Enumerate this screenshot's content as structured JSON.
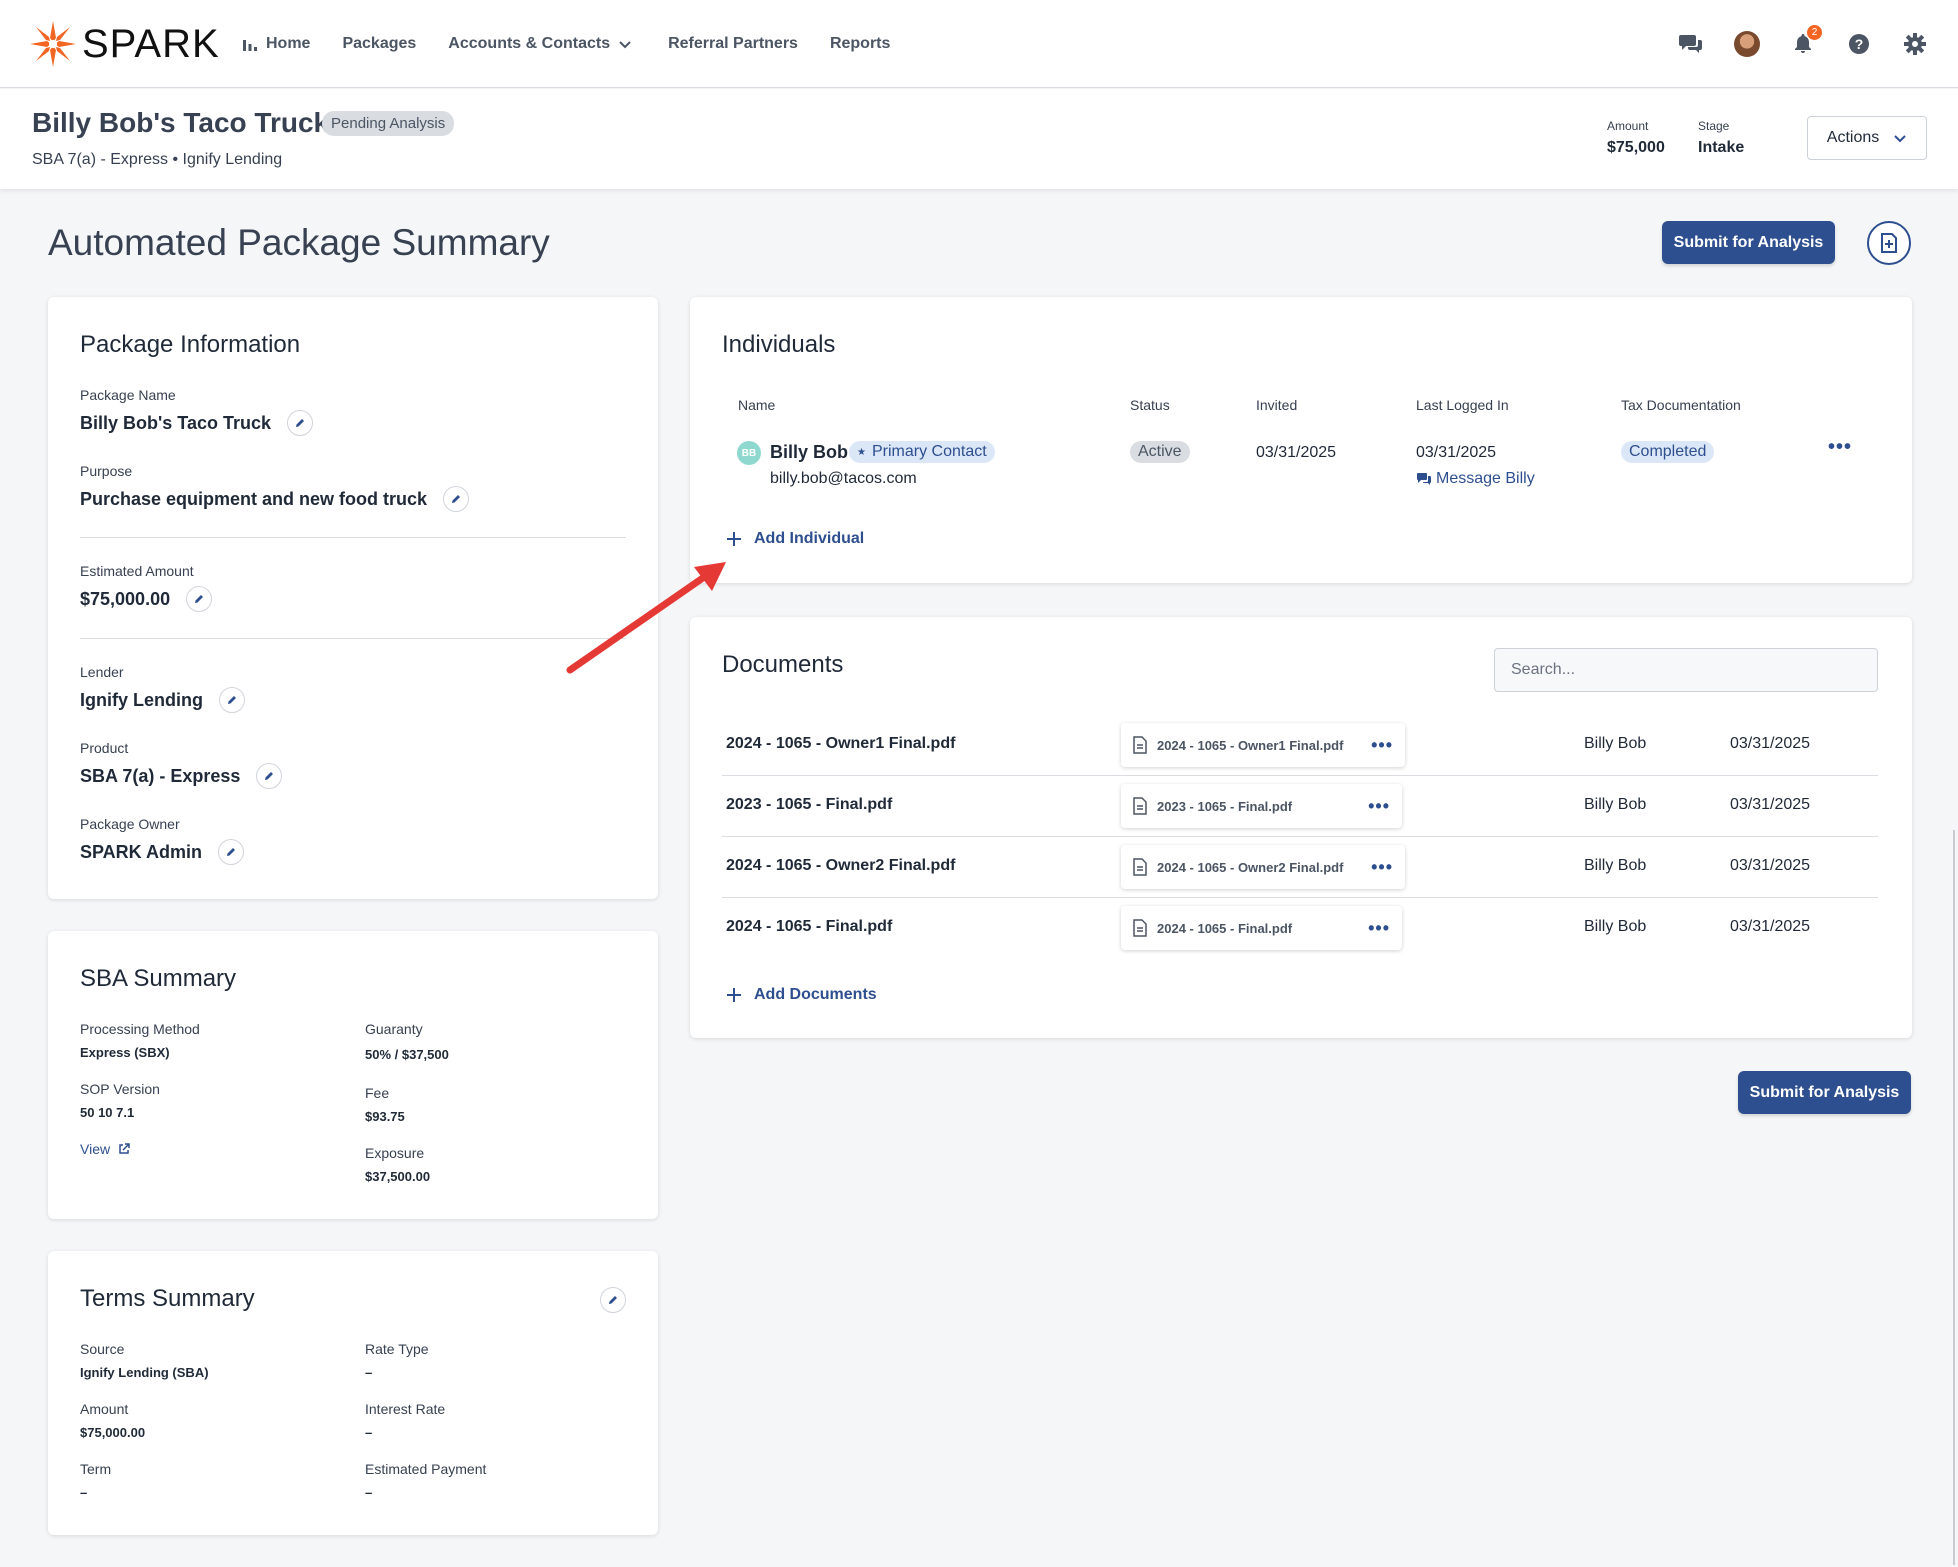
{
  "brand": {
    "name": "SPARK",
    "accent": "#f26522",
    "primary": "#2e4f8f"
  },
  "nav": {
    "items": [
      {
        "label": "Home",
        "icon": "bar-chart-icon"
      },
      {
        "label": "Packages"
      },
      {
        "label": "Accounts & Contacts",
        "icon": "chevron-down-icon"
      },
      {
        "label": "Referral Partners"
      },
      {
        "label": "Reports"
      }
    ],
    "notification_count": "2"
  },
  "header": {
    "title": "Billy Bob's Taco Truck",
    "status": "Pending Analysis",
    "subtitle": "SBA 7(a) - Express • Ignify Lending",
    "amount_label": "Amount",
    "amount_value": "$75,000",
    "stage_label": "Stage",
    "stage_value": "Intake",
    "actions_label": "Actions"
  },
  "page": {
    "title": "Automated Package Summary",
    "submit_label": "Submit for Analysis"
  },
  "package_info": {
    "title": "Package Information",
    "name_label": "Package Name",
    "name_value": "Billy Bob's Taco Truck",
    "purpose_label": "Purpose",
    "purpose_value": "Purchase equipment and new food truck",
    "estimated_label": "Estimated Amount",
    "estimated_value": "$75,000.00",
    "lender_label": "Lender",
    "lender_value": "Ignify Lending",
    "product_label": "Product",
    "product_value": "SBA 7(a) - Express",
    "owner_label": "Package Owner",
    "owner_value": "SPARK Admin"
  },
  "sba_summary": {
    "title": "SBA Summary",
    "processing_label": "Processing Method",
    "processing_value": "Express (SBX)",
    "sop_label": "SOP Version",
    "sop_value": "50 10 7.1",
    "view_label": "View",
    "guaranty_label": "Guaranty",
    "guaranty_value": "50% / $37,500",
    "fee_label": "Fee",
    "fee_value": "$93.75",
    "exposure_label": "Exposure",
    "exposure_value": "$37,500.00"
  },
  "terms_summary": {
    "title": "Terms Summary",
    "source_label": "Source",
    "source_value": "Ignify Lending (SBA)",
    "amount_label": "Amount",
    "amount_value": "$75,000.00",
    "term_label": "Term",
    "term_value": "–",
    "rate_type_label": "Rate Type",
    "rate_type_value": "–",
    "interest_label": "Interest Rate",
    "interest_value": "–",
    "payment_label": "Estimated Payment",
    "payment_value": "–"
  },
  "individuals": {
    "title": "Individuals",
    "columns": [
      "Name",
      "Status",
      "Invited",
      "Last Logged In",
      "Tax Documentation"
    ],
    "rows": [
      {
        "initials": "BB",
        "name": "Billy Bob",
        "role": "Primary Contact",
        "email": "billy.bob@tacos.com",
        "status": "Active",
        "invited": "03/31/2025",
        "last_logged_in": "03/31/2025",
        "message_label": "Message Billy",
        "tax_documentation": "Completed"
      }
    ],
    "add_label": "Add Individual"
  },
  "documents": {
    "title": "Documents",
    "search_placeholder": "Search...",
    "rows": [
      {
        "name": "2024 - 1065 - Owner1 Final.pdf",
        "file": "2024 - 1065 - Owner1 Final.pdf",
        "owner": "Billy Bob",
        "date": "03/31/2025"
      },
      {
        "name": "2023 - 1065 - Final.pdf",
        "file": "2023 - 1065 - Final.pdf",
        "owner": "Billy Bob",
        "date": "03/31/2025"
      },
      {
        "name": "2024 - 1065 - Owner2 Final.pdf",
        "file": "2024 - 1065 - Owner2 Final.pdf",
        "owner": "Billy Bob",
        "date": "03/31/2025"
      },
      {
        "name": "2024 - 1065 - Final.pdf",
        "file": "2024 - 1065 - Final.pdf",
        "owner": "Billy Bob",
        "date": "03/31/2025"
      }
    ],
    "add_label": "Add Documents"
  }
}
